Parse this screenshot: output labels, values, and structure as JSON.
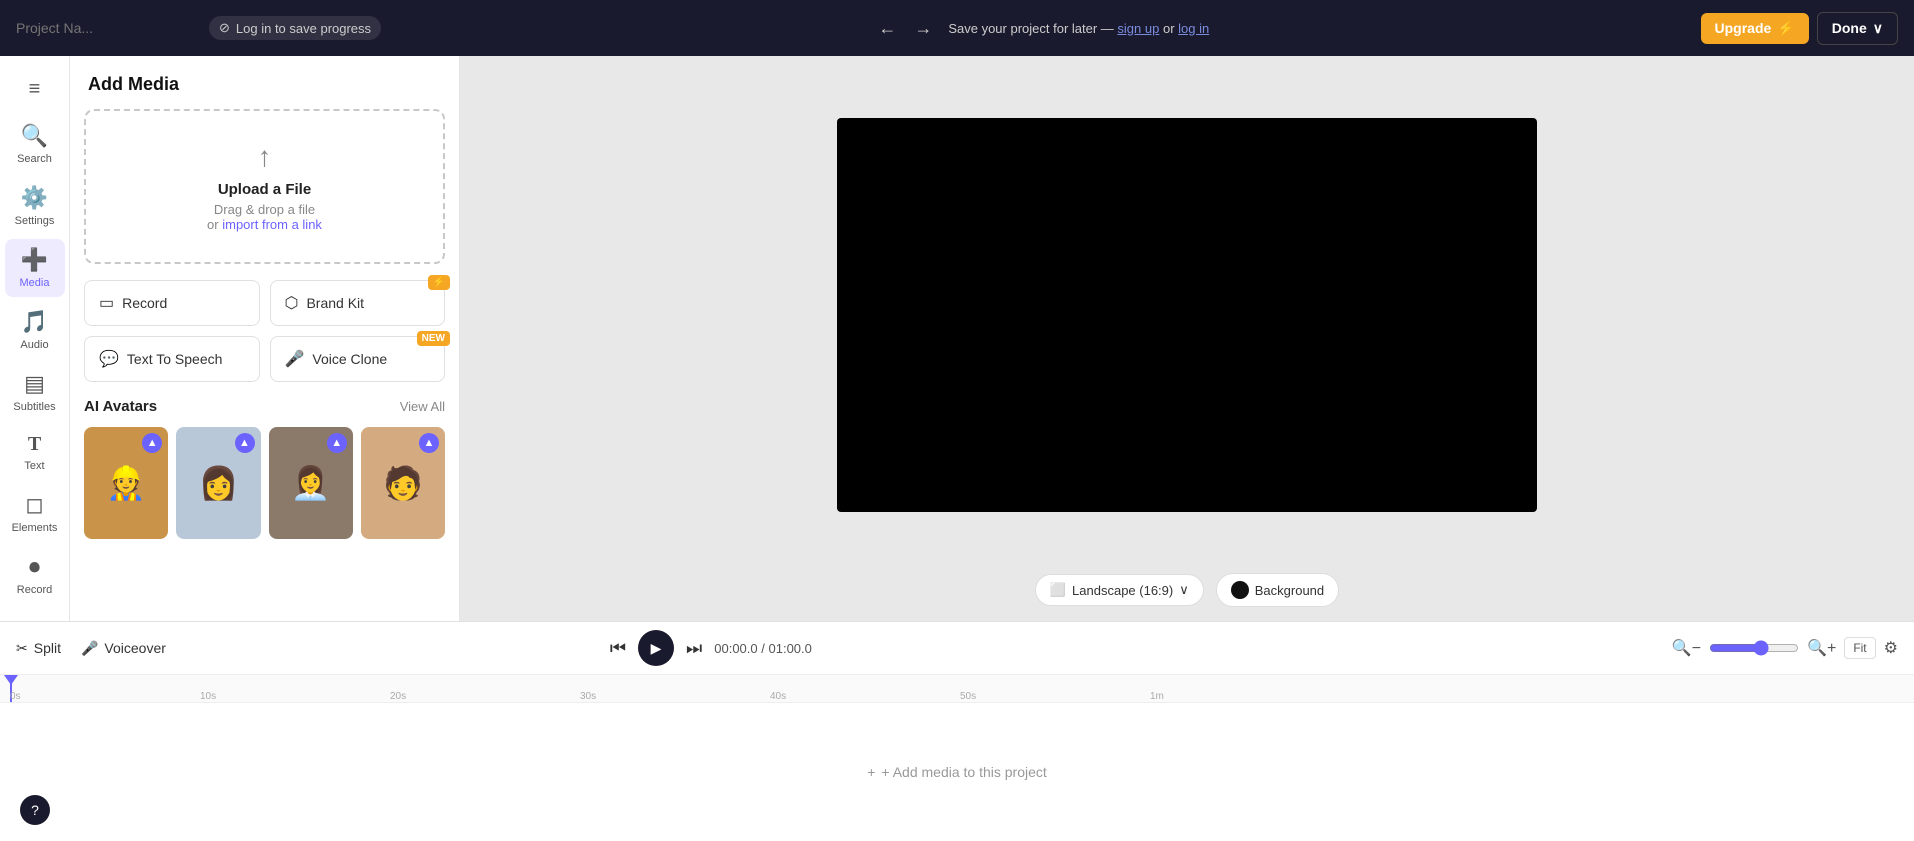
{
  "topbar": {
    "project_name_placeholder": "Project Na...",
    "offline_label": "Log in to save progress",
    "undo_label": "←",
    "redo_label": "→",
    "save_message": "Save your project for later —",
    "sign_up_label": "sign up",
    "or_label": "or",
    "log_in_label": "log in",
    "upgrade_label": "Upgrade",
    "done_label": "Done",
    "done_chevron": "∨"
  },
  "sidebar": {
    "menu_icon": "≡",
    "items": [
      {
        "id": "search",
        "label": "Search",
        "icon": "🔍"
      },
      {
        "id": "settings",
        "label": "Settings",
        "icon": "⚙️"
      },
      {
        "id": "media",
        "label": "Media",
        "icon": "➕",
        "active": true
      },
      {
        "id": "audio",
        "label": "Audio",
        "icon": "🎵"
      },
      {
        "id": "subtitles",
        "label": "Subtitles",
        "icon": "▤"
      },
      {
        "id": "text",
        "label": "Text",
        "icon": "T"
      },
      {
        "id": "elements",
        "label": "Elements",
        "icon": "◻"
      },
      {
        "id": "record",
        "label": "Record",
        "icon": "⏺"
      }
    ]
  },
  "panel": {
    "title": "Add Media",
    "upload_title": "Upload a File",
    "upload_sub1": "Drag & drop a file",
    "upload_sub2": "or",
    "upload_link": "import from a link",
    "buttons": [
      {
        "id": "record",
        "icon": "▭",
        "label": "Record"
      },
      {
        "id": "brand-kit",
        "icon": "⬡",
        "label": "Brand Kit",
        "badge": "⚡"
      },
      {
        "id": "text-to-speech",
        "icon": "💬",
        "label": "Text To Speech"
      },
      {
        "id": "voice-clone",
        "icon": "🎤",
        "label": "Voice Clone",
        "badge": "NEW"
      }
    ],
    "avatars_section_title": "AI Avatars",
    "view_all_label": "View All",
    "avatars": [
      {
        "id": "avatar1",
        "bg": "#c77c3a",
        "emoji": "👷"
      },
      {
        "id": "avatar2",
        "bg": "#d4a0b0",
        "emoji": "👩"
      },
      {
        "id": "avatar3",
        "bg": "#8b6a4a",
        "emoji": "👩‍💼"
      },
      {
        "id": "avatar4",
        "bg": "#c4956a",
        "emoji": "🧑"
      }
    ]
  },
  "canvas": {
    "aspect_label": "Landscape (16:9)",
    "aspect_chevron": "∨",
    "background_label": "Background"
  },
  "timeline": {
    "split_label": "Split",
    "voiceover_label": "Voiceover",
    "current_time": "00:00.0",
    "total_time": "01:00.0",
    "time_separator": "/",
    "fit_label": "Fit",
    "add_media_hint": "+ Add media to this project",
    "ruler_ticks": [
      "0s",
      "10s",
      "20s",
      "30s",
      "40s",
      "50s",
      "1m"
    ]
  }
}
